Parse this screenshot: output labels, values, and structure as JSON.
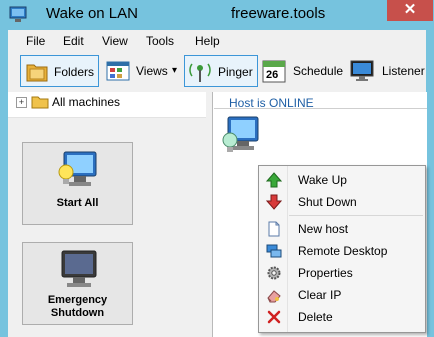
{
  "window": {
    "title": "Wake on LAN",
    "site": "freeware.tools",
    "close_glyph": "✕"
  },
  "menu": {
    "items": [
      "File",
      "Edit",
      "View",
      "Tools",
      "Help"
    ]
  },
  "toolbar": {
    "folders": "Folders",
    "views": "Views",
    "views_arrow": "▾",
    "pinger": "Pinger",
    "schedule": "Schedule",
    "schedule_day": "26",
    "listener": "Listener"
  },
  "tree": {
    "expander": "+",
    "root_label": "All machines"
  },
  "actions": {
    "start_all": "Start All",
    "emergency_line1": "Emergency",
    "emergency_line2": "Shutdown"
  },
  "main": {
    "status": "Host is ONLINE"
  },
  "context_menu": {
    "items": [
      {
        "label": "Wake Up",
        "icon": "arrow-up-icon"
      },
      {
        "label": "Shut Down",
        "icon": "arrow-down-icon"
      },
      {
        "label": "New host",
        "icon": "document-icon"
      },
      {
        "label": "Remote Desktop",
        "icon": "remote-desktop-icon"
      },
      {
        "label": "Properties",
        "icon": "gear-icon"
      },
      {
        "label": "Clear IP",
        "icon": "eraser-icon"
      },
      {
        "label": "Delete",
        "icon": "delete-x-icon"
      }
    ]
  },
  "colors": {
    "titlebar": "#76c3de",
    "close": "#c7504b",
    "status_text": "#1f5fa5",
    "toolbar_active_border": "#3c96d8"
  }
}
